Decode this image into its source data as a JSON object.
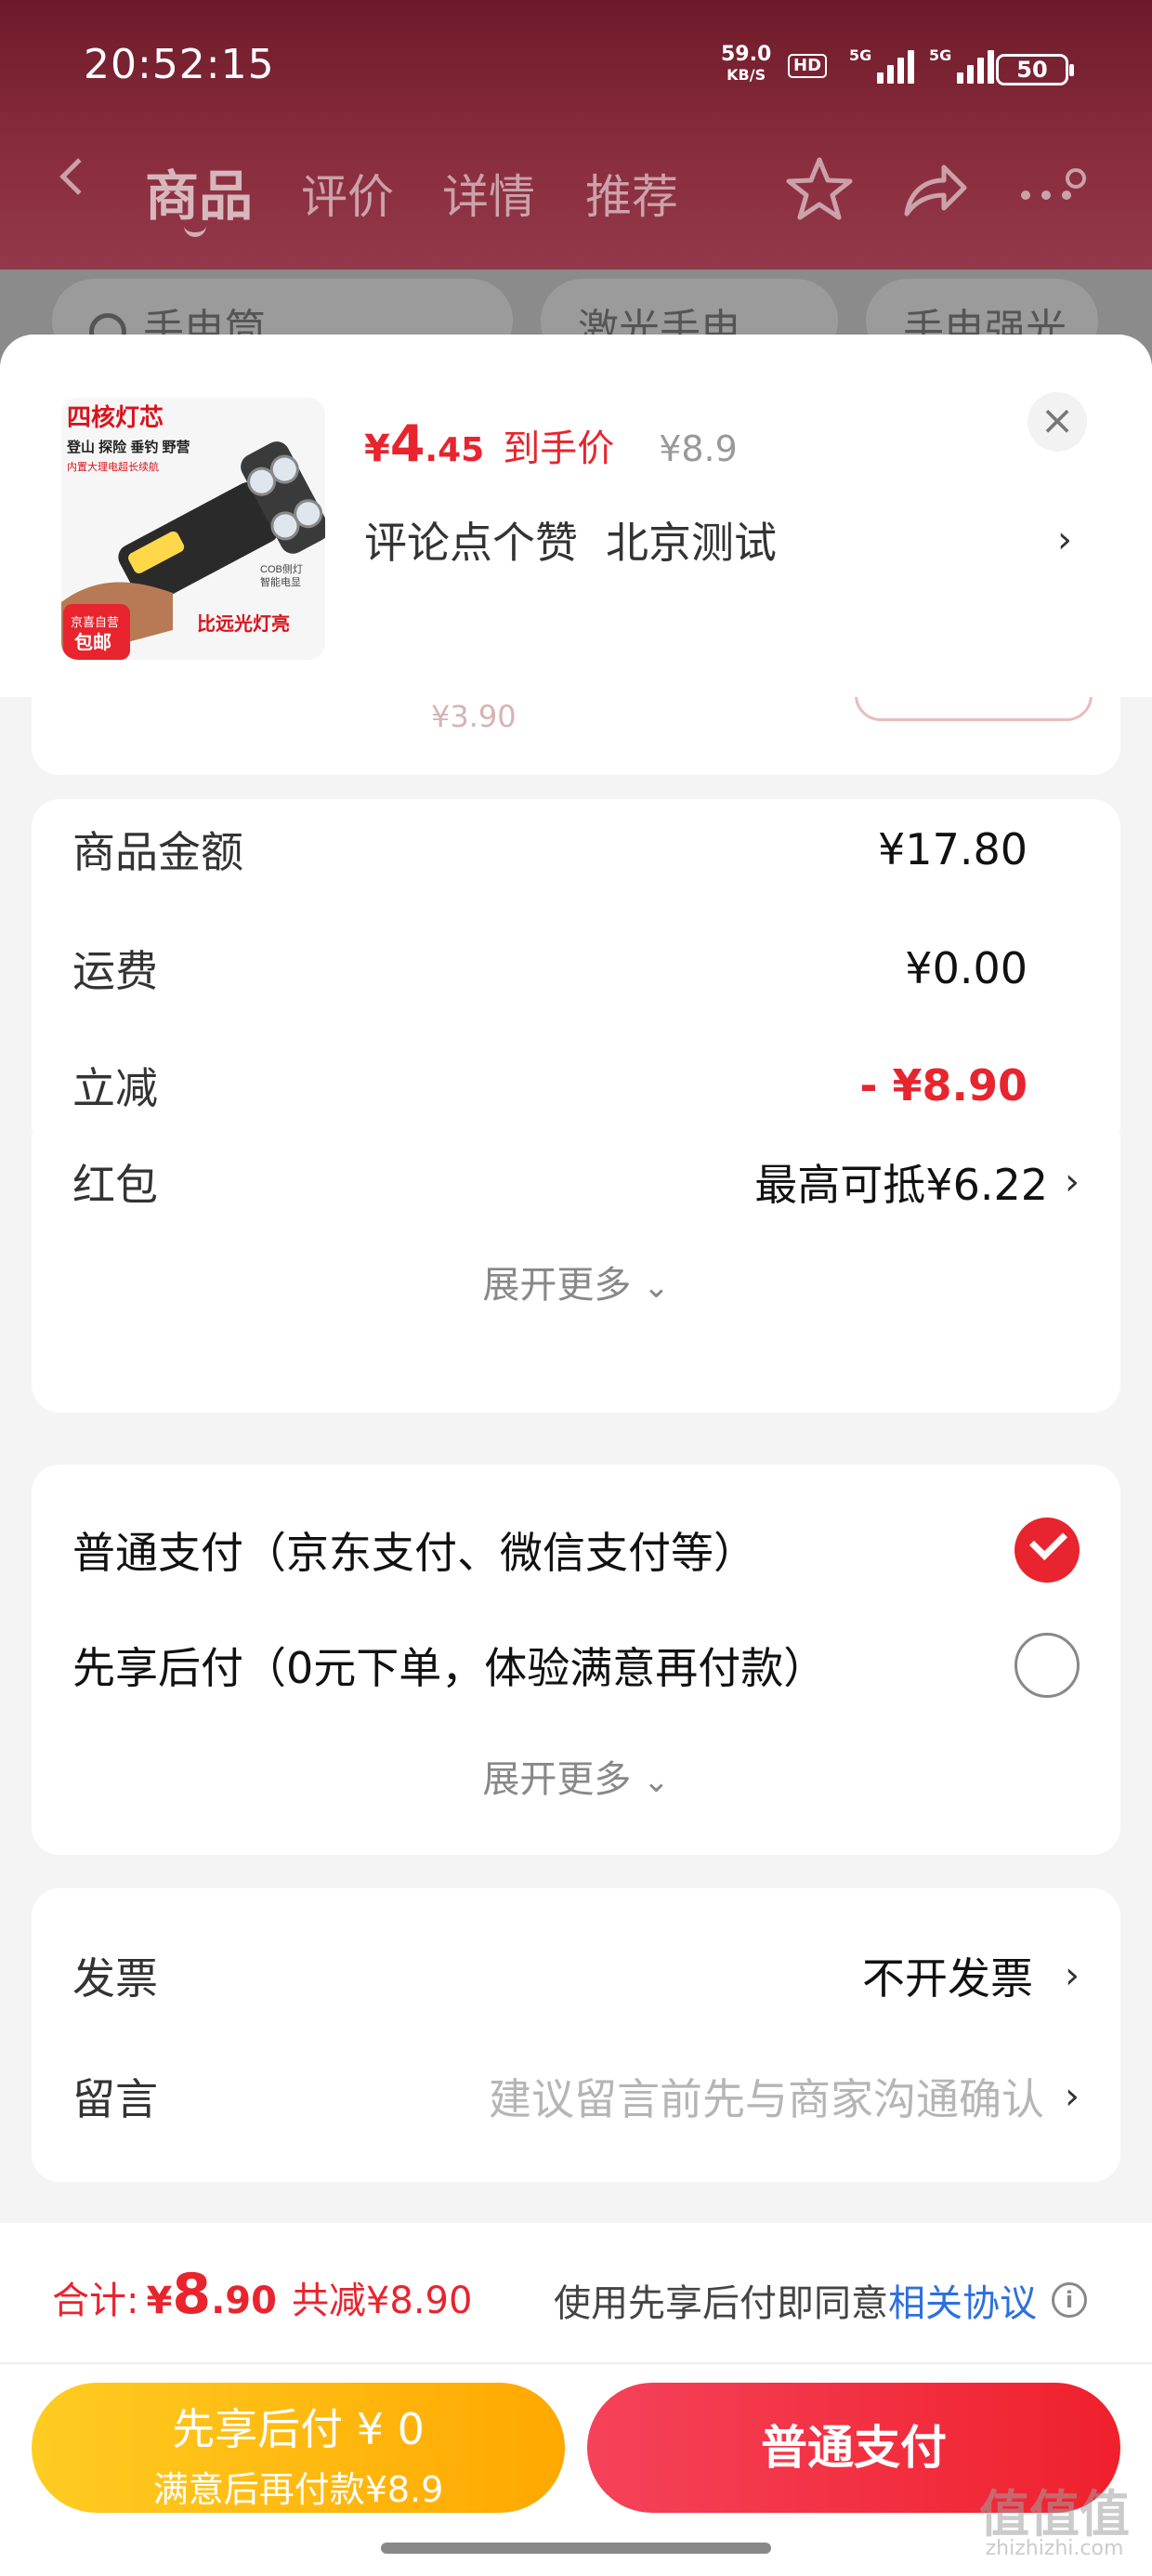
{
  "status_bar": {
    "time": "20:52:15",
    "net_speed": "59.0",
    "net_unit": "KB/S",
    "hd": "HD",
    "sim1": "5G",
    "sim2": "5G",
    "battery": "50"
  },
  "nav": {
    "tabs": [
      {
        "label": "商品",
        "active": true
      },
      {
        "label": "评价",
        "active": false
      },
      {
        "label": "详情",
        "active": false
      },
      {
        "label": "推荐",
        "active": false
      }
    ],
    "icons": [
      "back-icon",
      "star-icon",
      "share-icon",
      "more-icon"
    ]
  },
  "search_chips": [
    "手电筒",
    "激光手电",
    "手电强光"
  ],
  "product": {
    "image_texts": {
      "headline": "四核灯芯",
      "tags": "登山 探险 垂钓 野营",
      "battery_note": "内置大理电超长续航",
      "cob": "COB侧灯",
      "smart": "智能电显",
      "compare": "比远光灯亮",
      "badge_top": "京喜自营",
      "badge_bottom": "包邮"
    },
    "price_currency": "¥",
    "price_int": "4",
    "price_dec": ".45",
    "price_label": "到手价",
    "original_price": "¥8.9",
    "spec_1": "评论点个赞",
    "spec_2": "北京测试",
    "close_label": "×"
  },
  "amounts": {
    "rows": [
      {
        "label": "商品金额",
        "value": "¥17.80"
      },
      {
        "label": "运费",
        "value": "¥0.00"
      },
      {
        "label": "立减",
        "value": "- ¥8.90"
      },
      {
        "label": "红包",
        "value": "最高可抵¥6.22"
      }
    ],
    "expand": "展开更多"
  },
  "payment": {
    "options": [
      {
        "label": "普通支付（京东支付、微信支付等）",
        "selected": true
      },
      {
        "label": "先享后付（0元下单，体验满意再付款）",
        "selected": false
      }
    ],
    "expand": "展开更多"
  },
  "extras": {
    "invoice_label": "发票",
    "invoice_value": "不开发票",
    "message_label": "留言",
    "message_placeholder": "建议留言前先与商家沟通确认"
  },
  "footer": {
    "total_label": "合计:",
    "total_currency": "¥",
    "total_int": "8",
    "total_dec": ".90",
    "total_saving": "共减¥8.90",
    "agreement_prefix": "使用先享后付即同意",
    "agreement_link": "相关协议",
    "btn_later_line1": "先享后付 ¥ 0",
    "btn_later_line2": "满意后再付款¥8.9",
    "btn_pay": "普通支付"
  },
  "watermark": {
    "main": "值值值",
    "sub": "zhizhizhi.com"
  },
  "colors": {
    "accent_red": "#e8242e",
    "yellow": "#ffb400",
    "link_blue": "#2d6fe0"
  }
}
